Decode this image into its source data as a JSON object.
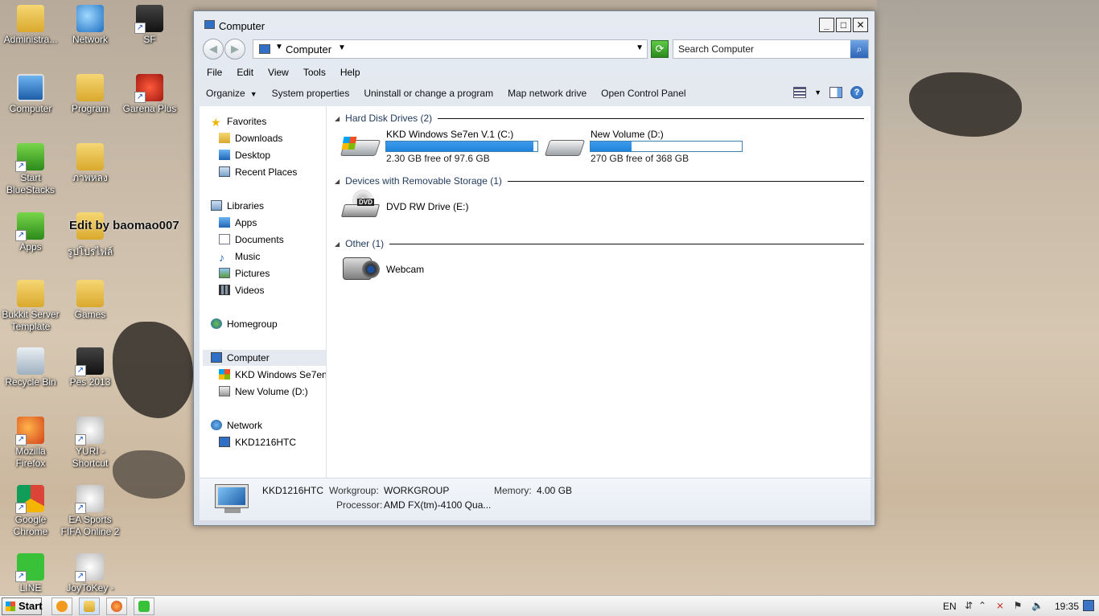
{
  "desktop": {
    "icons": [
      {
        "label": "Administra...",
        "icon": "user-folder-icon"
      },
      {
        "label": "Network",
        "icon": "network-icon"
      },
      {
        "label": "SF",
        "icon": "sf-game-icon"
      },
      {
        "label": "Computer",
        "icon": "computer-icon"
      },
      {
        "label": "Program",
        "icon": "folder-icon"
      },
      {
        "label": "Garena Plus",
        "icon": "garena-icon"
      },
      {
        "label": "Start BlueStacks",
        "icon": "bluestacks-icon"
      },
      {
        "label": "ภาพหลง",
        "icon": "folder-icon"
      },
      {
        "label": "Apps",
        "icon": "android-apps-icon"
      },
      {
        "label": "รูปโปรไฟล์",
        "icon": "folder-icon"
      },
      {
        "label": "Bukkit Server Template",
        "icon": "folder-icon"
      },
      {
        "label": "Games",
        "icon": "folder-icon"
      },
      {
        "label": "Recycle Bin",
        "icon": "recycle-bin-icon"
      },
      {
        "label": "Pes 2013",
        "icon": "pes-icon"
      },
      {
        "label": "Mozilla Firefox",
        "icon": "firefox-icon"
      },
      {
        "label": "YURI - Shortcut",
        "icon": "yuri-icon"
      },
      {
        "label": "Google Chrome",
        "icon": "chrome-icon"
      },
      {
        "label": "EA Sports FIFA Online 2",
        "icon": "fifa-icon"
      },
      {
        "label": "LINE",
        "icon": "line-icon"
      },
      {
        "label": "JoyToKey -",
        "icon": "joytokey-icon"
      }
    ],
    "watermark": "Edit by baomao007"
  },
  "window": {
    "title": "Computer",
    "caption_buttons": {
      "minimize": "_",
      "maximize": "□",
      "close": "✕"
    },
    "address": {
      "crumb": "Computer"
    },
    "search_placeholder": "Search Computer",
    "menu": [
      "File",
      "Edit",
      "View",
      "Tools",
      "Help"
    ],
    "commands": {
      "organize": "Organize",
      "system_properties": "System properties",
      "uninstall": "Uninstall or change a program",
      "map_drive": "Map network drive",
      "control_panel": "Open Control Panel"
    },
    "nav": {
      "favorites": "Favorites",
      "downloads": "Downloads",
      "desktop": "Desktop",
      "recent": "Recent Places",
      "libraries": "Libraries",
      "apps": "Apps",
      "documents": "Documents",
      "music": "Music",
      "pictures": "Pictures",
      "videos": "Videos",
      "homegroup": "Homegroup",
      "computer": "Computer",
      "drive_c": "KKD Windows Se7en",
      "drive_d": "New Volume (D:)",
      "network": "Network",
      "network_pc": "KKD1216HTC"
    },
    "groups": {
      "hdd": "Hard Disk Drives (2)",
      "removable": "Devices with Removable Storage (1)",
      "other": "Other (1)"
    },
    "drives": {
      "c": {
        "name": "KKD Windows Se7en V.1 (C:)",
        "free": "2.30 GB free of 97.6 GB",
        "used_fraction": 0.976
      },
      "d": {
        "name": "New Volume (D:)",
        "free": "270 GB free of 368 GB",
        "used_fraction": 0.27
      }
    },
    "dvd": {
      "name": "DVD RW Drive (E:)",
      "disc_label": "DVD"
    },
    "webcam": {
      "name": "Webcam"
    },
    "details": {
      "pc_name": "KKD1216HTC",
      "workgroup_label": "Workgroup:",
      "workgroup": "WORKGROUP",
      "memory_label": "Memory:",
      "memory": "4.00 GB",
      "processor_label": "Processor:",
      "processor": "AMD FX(tm)-4100 Qua..."
    }
  },
  "taskbar": {
    "start_label": "Start",
    "language": "EN",
    "clock": "19:35"
  }
}
